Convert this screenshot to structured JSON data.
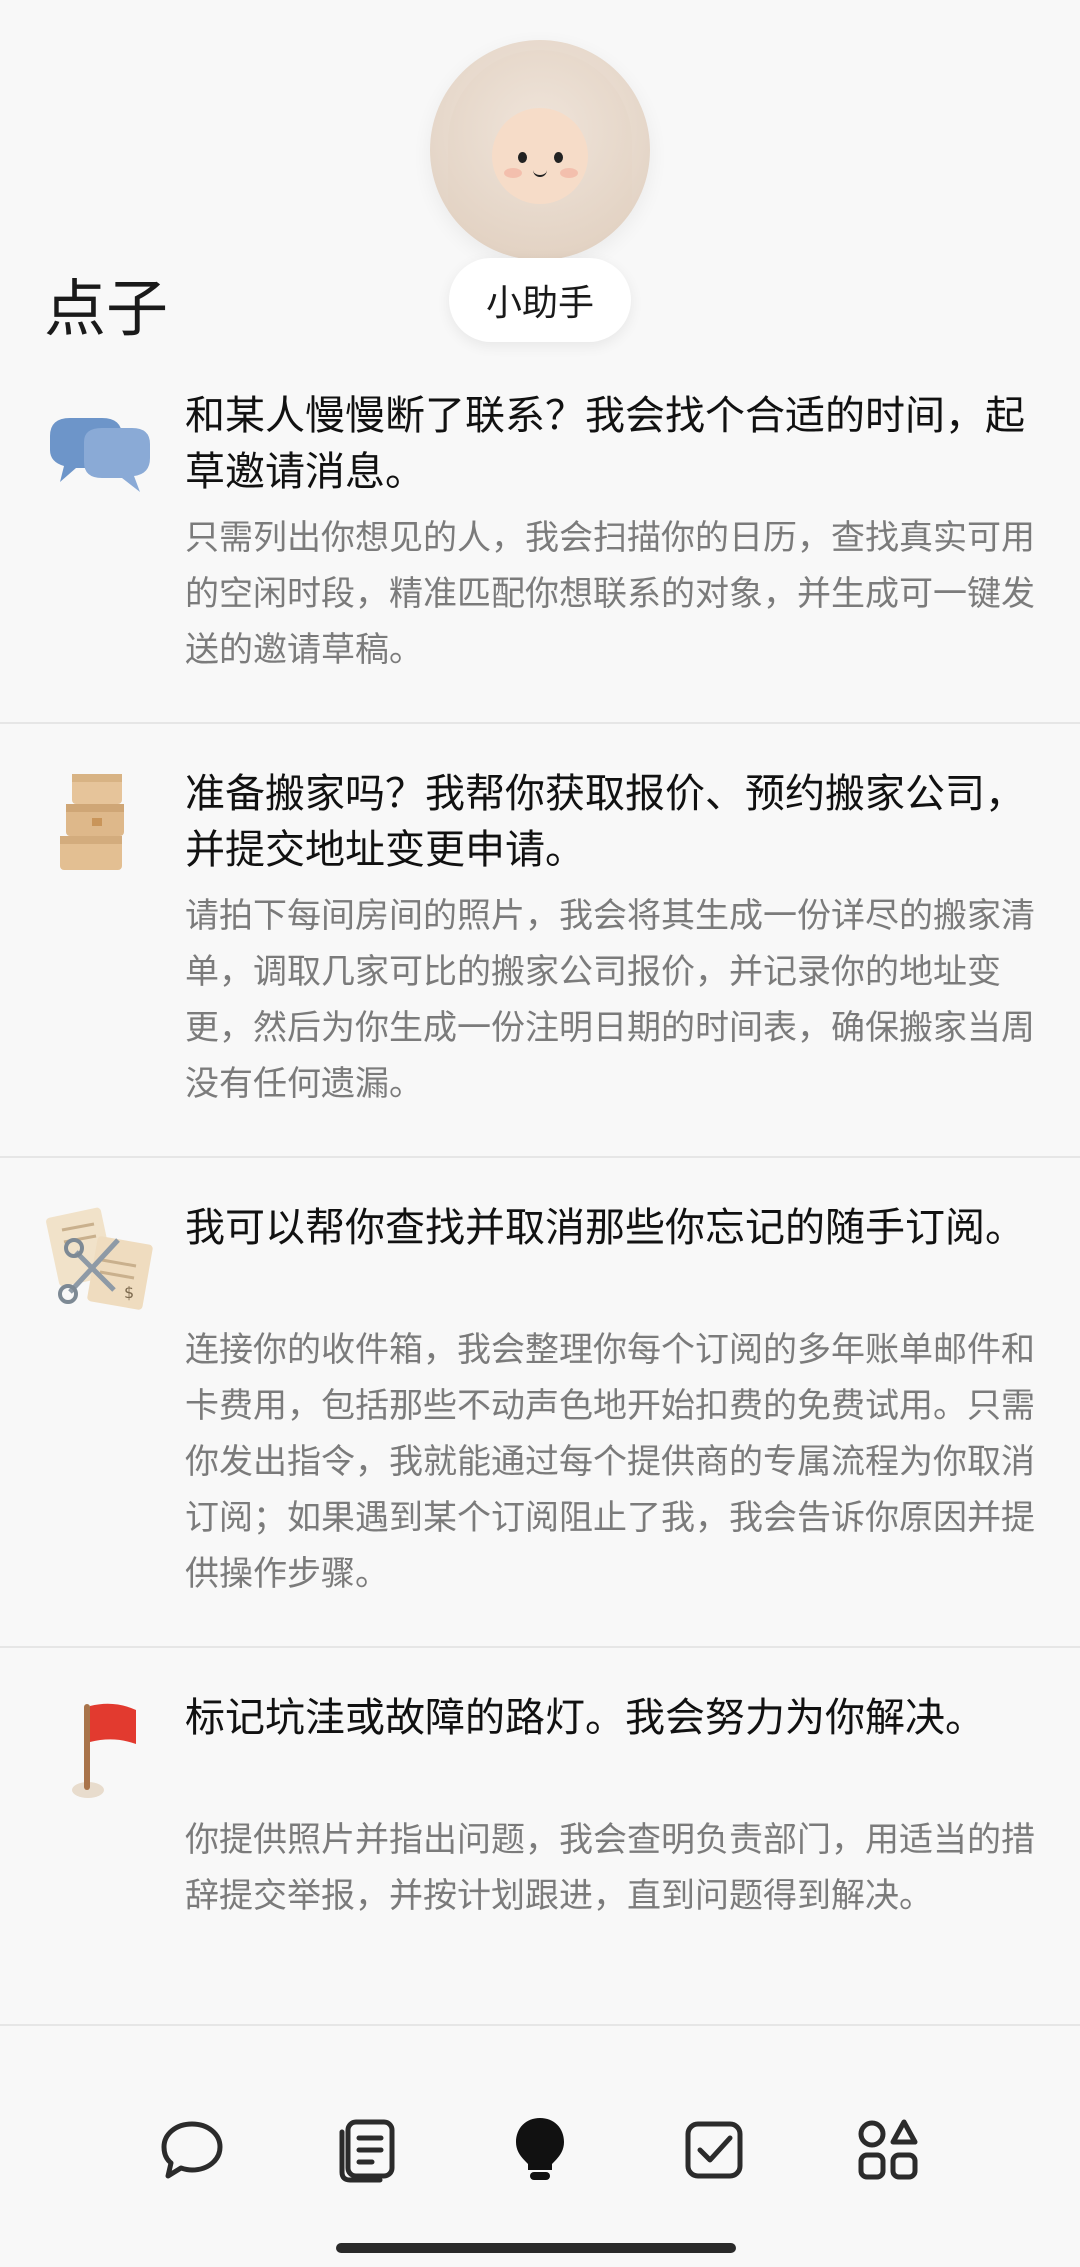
{
  "header": {
    "title": "点子",
    "assistant_label": "小助手"
  },
  "ideas": [
    {
      "icon": "speech-bubbles-icon",
      "title": "和某人慢慢断了联系？我会找个合适的时间，起草邀请消息。",
      "description": "只需列出你想见的人，我会扫描你的日历，查找真实可用的空闲时段，精准匹配你想联系的对象，并生成可一键发送的邀请草稿。"
    },
    {
      "icon": "moving-boxes-icon",
      "title": "准备搬家吗？我帮你获取报价、预约搬家公司，并提交地址变更申请。",
      "description": "请拍下每间房间的照片，我会将其生成一份详尽的搬家清单，调取几家可比的搬家公司报价，并记录你的地址变更，然后为你生成一份注明日期的时间表，确保搬家当周没有任何遗漏。"
    },
    {
      "icon": "scissors-receipt-icon",
      "title": "我可以帮你查找并取消那些你忘记的随手订阅。",
      "description": "连接你的收件箱，我会整理你每个订阅的多年账单邮件和卡费用，包括那些不动声色地开始扣费的免费试用。只需你发出指令，我就能通过每个提供商的专属流程为你取消订阅；如果遇到某个订阅阻止了我，我会告诉你原因并提供操作步骤。"
    },
    {
      "icon": "red-flag-icon",
      "title": "标记坑洼或故障的路灯。我会努力为你解决。",
      "description": "你提供照片并指出问题，我会查明负责部门，用适当的措辞提交举报，并按计划跟进，直到问题得到解决。"
    }
  ],
  "nav": {
    "items": [
      "chat-icon",
      "notes-icon",
      "ideas-icon",
      "tasks-icon",
      "apps-icon"
    ],
    "active": "ideas-icon",
    "colors": {
      "icon": "#2b2b2b",
      "active": "#111111"
    }
  }
}
